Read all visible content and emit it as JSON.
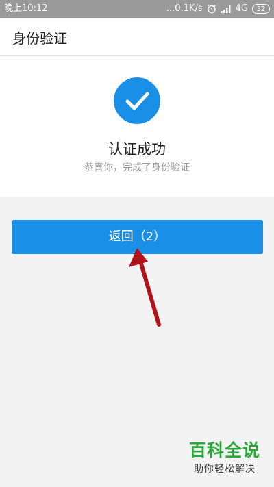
{
  "status_bar": {
    "time": "晚上10:12",
    "network_speed": "...0.1K/s",
    "network_type": "4G",
    "battery": "32",
    "icons": [
      "alarm-icon",
      "signal-icon"
    ]
  },
  "header": {
    "title": "身份验证"
  },
  "result": {
    "icon": "checkmark-icon",
    "title": "认证成功",
    "subtitle": "恭喜你，完成了身份验证"
  },
  "actions": {
    "back_label": "返回（2）"
  },
  "watermark": {
    "main": "百科全说",
    "sub": "助你轻松解决"
  },
  "colors": {
    "accent": "#1a8fe8",
    "status_bar": "#9a9a9a",
    "arrow": "#b0141a",
    "watermark_green": "#2ba83a"
  }
}
